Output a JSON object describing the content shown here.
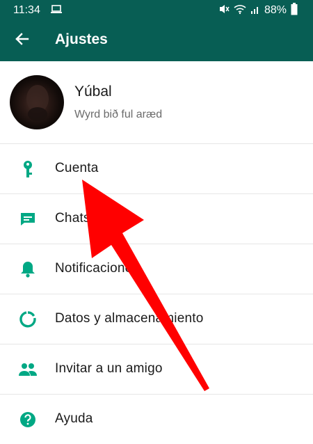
{
  "status_bar": {
    "time": "11:34",
    "battery": "88%",
    "left_icon": "laptop-icon",
    "right_icons": [
      "mute-icon",
      "wifi-icon",
      "signal-icon",
      "battery-icon"
    ]
  },
  "app_bar": {
    "title": "Ajustes",
    "back_icon": "arrow-back-icon"
  },
  "profile": {
    "name": "Yúbal",
    "status": "Wyrd bið ful aræd"
  },
  "menu": {
    "items": [
      {
        "label": "Cuenta",
        "icon": "key-icon"
      },
      {
        "label": "Chats",
        "icon": "chat-icon"
      },
      {
        "label": "Notificaciones",
        "icon": "bell-icon"
      },
      {
        "label": "Datos y almacenamiento",
        "icon": "data-usage-icon"
      },
      {
        "label": "Invitar a un amigo",
        "icon": "people-icon"
      },
      {
        "label": "Ayuda",
        "icon": "help-icon"
      }
    ]
  },
  "colors": {
    "app_bar": "#075e54",
    "accent_icon": "#00a884",
    "annotation_arrow": "#ff0000"
  }
}
